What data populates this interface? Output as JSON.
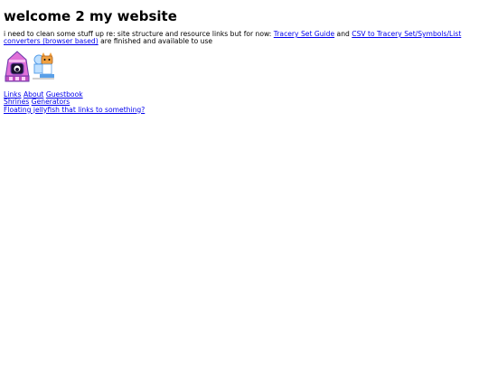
{
  "page": {
    "title": "welcome 2 my website",
    "intro": {
      "text_before": "i need to clean some stuff up re: site structure and resource links but for now: ",
      "link1": "Tracery Set Guide",
      "text_between": " and ",
      "link2": "CSV to Tracery Set/Symbols/List converters (browser based)",
      "text_after": " are finished and available to use"
    },
    "badges": {
      "left_icon": "pink-backpack-pixel-icon",
      "right_icon": "cat-characters-pixel-icon",
      "colors": {
        "pink": "#e070d8",
        "purple": "#6a3aa8",
        "blue": "#5aa0e8",
        "orange": "#f0a040"
      }
    },
    "nav": {
      "row1": [
        "Links",
        "About",
        "Guestbook"
      ],
      "row2": [
        "Shrines",
        "Generators"
      ],
      "row3": [
        "Floating jellyfish that links to something?"
      ]
    }
  }
}
